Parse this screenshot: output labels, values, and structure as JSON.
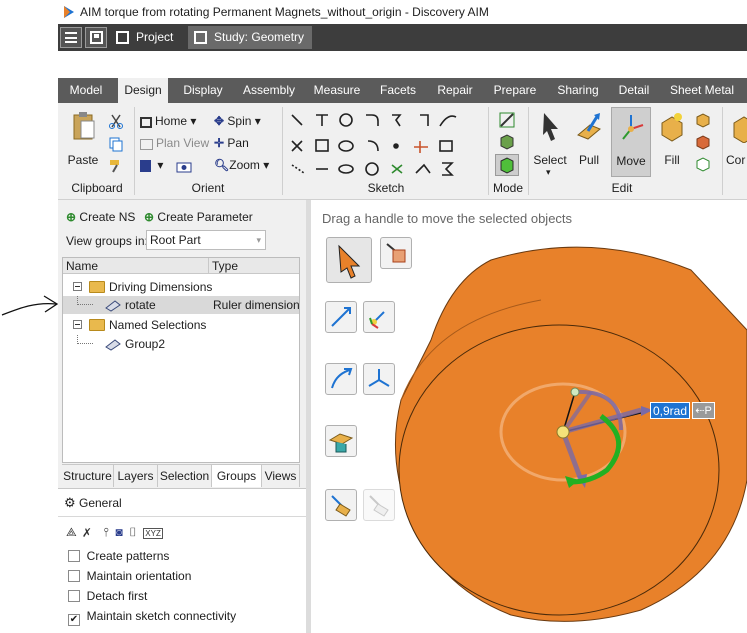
{
  "window": {
    "title": "AIM torque from rotating Permanent Magnets_without_origin - Discovery AIM"
  },
  "doc_tabs": [
    {
      "label": "Project"
    },
    {
      "label": "Study: Geometry"
    }
  ],
  "ribbon_tabs": [
    "Model",
    "Design",
    "Display",
    "Assembly",
    "Measure",
    "Facets",
    "Repair",
    "Prepare",
    "Sharing",
    "Detail",
    "Sheet Metal"
  ],
  "active_ribbon_tab": "Design",
  "groups": {
    "clipboard": {
      "label": "Clipboard",
      "paste": "Paste"
    },
    "orient": {
      "label": "Orient",
      "home": "Home",
      "spin": "Spin",
      "plan_view": "Plan View",
      "pan": "Pan",
      "zoom": "Zoom"
    },
    "sketch": {
      "label": "Sketch"
    },
    "mode": {
      "label": "Mode"
    },
    "edit": {
      "label": "Edit",
      "select": "Select",
      "pull": "Pull",
      "move": "Move",
      "fill": "Fill",
      "combine_partial": "Cor"
    }
  },
  "panel": {
    "create_ns": "Create NS",
    "create_parameter": "Create Parameter",
    "view_groups_label": "View groups in:",
    "view_groups_value": "Root Part",
    "columns": {
      "name": "Name",
      "type": "Type"
    },
    "tree": {
      "driving_dimensions": "Driving Dimensions",
      "rotate_name": "rotate",
      "rotate_type": "Ruler dimension",
      "named_selections": "Named Selections",
      "group2": "Group2"
    },
    "tabs": [
      "Structure",
      "Layers",
      "Selection",
      "Groups",
      "Views"
    ],
    "active_tab": "Groups"
  },
  "options": {
    "title": "General",
    "icon_xyz": "XYZ",
    "items": [
      {
        "label": "Create patterns",
        "checked": false
      },
      {
        "label": "Maintain orientation",
        "checked": false
      },
      {
        "label": "Detach first",
        "checked": false
      },
      {
        "label": "Maintain sketch connectivity",
        "checked": true
      }
    ]
  },
  "viewport": {
    "hint": "Drag a handle to move the selected objects",
    "angle_value": "0,9rad",
    "angle_suffix": "P"
  },
  "colors": {
    "accent": "#e8812a",
    "selection": "#1e73d2",
    "tab_dark": "#3d3d3d",
    "ribbon_tabs": "#5b5b5b"
  }
}
